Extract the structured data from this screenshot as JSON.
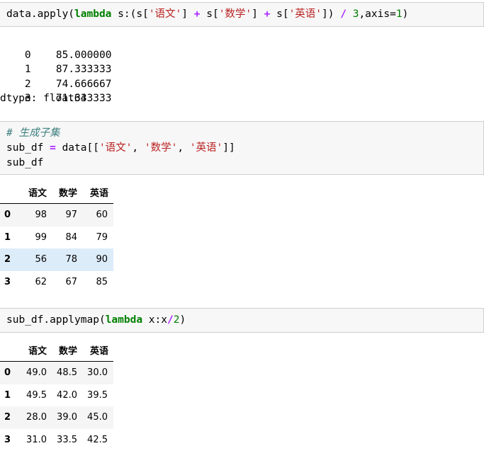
{
  "cells": [
    {
      "id": "cell-apply",
      "lines": [
        [
          {
            "t": "data.apply(",
            "c": ""
          },
          {
            "t": "lambda",
            "c": "kw"
          },
          {
            "t": " s:(s[",
            "c": ""
          },
          {
            "t": "'语文'",
            "c": "str"
          },
          {
            "t": "] ",
            "c": ""
          },
          {
            "t": "+",
            "c": "op"
          },
          {
            "t": " s[",
            "c": ""
          },
          {
            "t": "'数学'",
            "c": "str"
          },
          {
            "t": "] ",
            "c": ""
          },
          {
            "t": "+",
            "c": "op"
          },
          {
            "t": " s[",
            "c": ""
          },
          {
            "t": "'英语'",
            "c": "str"
          },
          {
            "t": "]) ",
            "c": ""
          },
          {
            "t": "/",
            "c": "op"
          },
          {
            "t": " ",
            "c": ""
          },
          {
            "t": "3",
            "c": "num"
          },
          {
            "t": ",axis=",
            "c": ""
          },
          {
            "t": "1",
            "c": "num"
          },
          {
            "t": ")",
            "c": ""
          }
        ]
      ]
    },
    {
      "id": "cell-subdf",
      "lines": [
        [
          {
            "t": "# 生成子集",
            "c": "cm"
          }
        ],
        [
          {
            "t": "sub_df ",
            "c": ""
          },
          {
            "t": "=",
            "c": "op"
          },
          {
            "t": " data[[",
            "c": ""
          },
          {
            "t": "'语文'",
            "c": "str"
          },
          {
            "t": ", ",
            "c": ""
          },
          {
            "t": "'数学'",
            "c": "str"
          },
          {
            "t": ", ",
            "c": ""
          },
          {
            "t": "'英语'",
            "c": "str"
          },
          {
            "t": "]]",
            "c": ""
          }
        ],
        [
          {
            "t": "sub_df",
            "c": ""
          }
        ]
      ]
    },
    {
      "id": "cell-applymap",
      "lines": [
        [
          {
            "t": "sub_df.applymap(",
            "c": ""
          },
          {
            "t": "lambda",
            "c": "kw"
          },
          {
            "t": " x:x",
            "c": ""
          },
          {
            "t": "/",
            "c": "op"
          },
          {
            "t": "2",
            "c": "num"
          },
          {
            "t": ")",
            "c": ""
          }
        ]
      ]
    }
  ],
  "series_output": {
    "rows": [
      {
        "index": "0",
        "value": "85.000000"
      },
      {
        "index": "1",
        "value": "87.333333"
      },
      {
        "index": "2",
        "value": "74.666667"
      },
      {
        "index": "3",
        "value": "71.333333"
      }
    ],
    "dtype": "dtype: float64"
  },
  "table1": {
    "columns": [
      "语文",
      "数学",
      "英语"
    ],
    "rows": [
      {
        "index": "0",
        "values": [
          "98",
          "97",
          "60"
        ]
      },
      {
        "index": "1",
        "values": [
          "99",
          "84",
          "79"
        ]
      },
      {
        "index": "2",
        "values": [
          "56",
          "78",
          "90"
        ]
      },
      {
        "index": "3",
        "values": [
          "62",
          "67",
          "85"
        ]
      }
    ],
    "hover_row": 2
  },
  "table2": {
    "columns": [
      "语文",
      "数学",
      "英语"
    ],
    "rows": [
      {
        "index": "0",
        "values": [
          "49.0",
          "48.5",
          "30.0"
        ]
      },
      {
        "index": "1",
        "values": [
          "49.5",
          "42.0",
          "39.5"
        ]
      },
      {
        "index": "2",
        "values": [
          "28.0",
          "39.0",
          "45.0"
        ]
      },
      {
        "index": "3",
        "values": [
          "31.0",
          "33.5",
          "42.5"
        ]
      }
    ],
    "hover_row": -1
  },
  "colors": {
    "keyword": "#008000",
    "operator": "#aa22ff",
    "string": "#ba2121",
    "comment": "#408080",
    "cell_bg": "#f7f7f7",
    "row_hover": "#ddecf9"
  }
}
